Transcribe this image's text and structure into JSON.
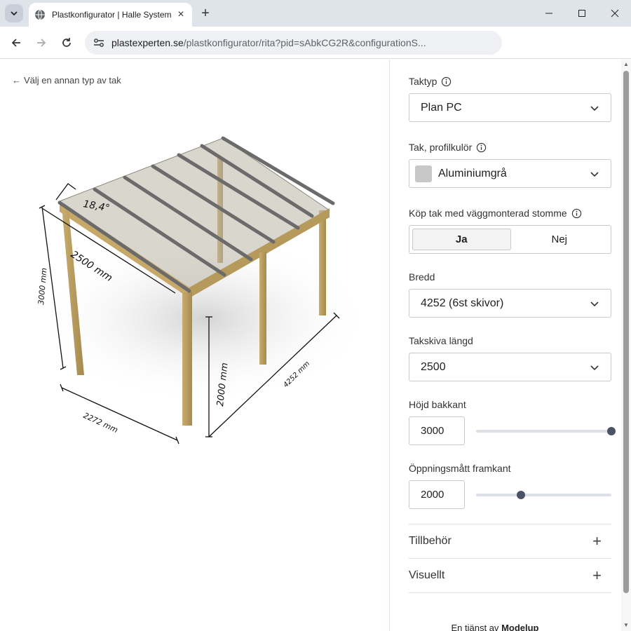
{
  "browser": {
    "tab_title": "Plastkonfigurator | Halle System",
    "url_host": "plastexperten.se",
    "url_path": "/plastkonfigurator/rita?pid=sAbkCG2R&configurationS..."
  },
  "viewer": {
    "back_link": "Välj en annan typ av tak",
    "dimensions": {
      "angle": "18,4°",
      "length": "2500 mm",
      "rear_height": "3000 mm",
      "front_height": "2000 mm",
      "width": "4252 mm",
      "depth": "2272 mm"
    }
  },
  "panel": {
    "taktyp": {
      "label": "Taktyp",
      "value": "Plan PC"
    },
    "profilkulor": {
      "label": "Tak, profilkulör",
      "value": "Aluminiumgrå",
      "swatch_color": "#c8c8c8"
    },
    "vaggmonterad": {
      "label": "Köp tak med väggmonterad stomme",
      "yes": "Ja",
      "no": "Nej",
      "selected": "Ja"
    },
    "bredd": {
      "label": "Bredd",
      "value": "4252 (6st skivor)"
    },
    "takskiva": {
      "label": "Takskiva längd",
      "value": "2500"
    },
    "hojd_bakkant": {
      "label": "Höjd bakkant",
      "value": "3000",
      "slider_fraction": 1.0
    },
    "oppningsmatt": {
      "label": "Öppningsmått framkant",
      "value": "2000",
      "slider_fraction": 0.33
    },
    "tillbehor": {
      "label": "Tillbehör"
    },
    "visuellt": {
      "label": "Visuellt"
    },
    "footer_prefix": "En tjänst av",
    "footer_brand": "Modelup"
  }
}
